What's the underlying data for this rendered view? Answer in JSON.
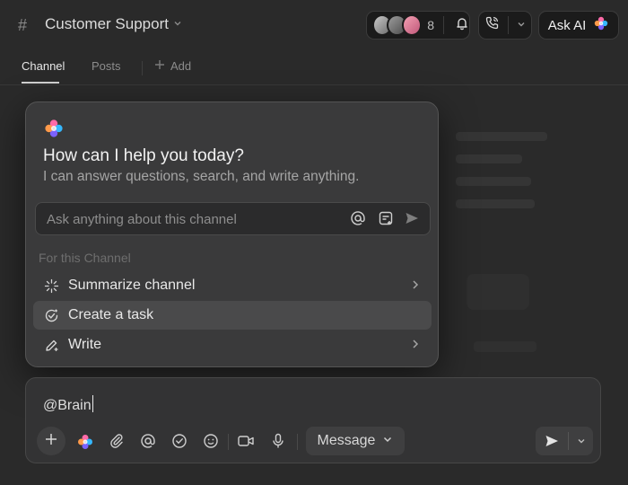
{
  "header": {
    "channel_title": "Customer Support",
    "member_count": "8",
    "ask_ai_label": "Ask AI"
  },
  "tabs": [
    {
      "label": "Channel",
      "active": true
    },
    {
      "label": "Posts",
      "active": false
    },
    {
      "label": "Add",
      "active": false
    }
  ],
  "assistant": {
    "heading": "How can I help you today?",
    "subheading": "I can answer questions, search, and write anything.",
    "input_placeholder": "Ask anything about this channel",
    "section_label": "For this Channel",
    "items": [
      {
        "label": "Summarize channel",
        "icon": "sparkle-icon",
        "has_submenu": true
      },
      {
        "label": "Create a task",
        "icon": "task-check-icon",
        "has_submenu": false
      },
      {
        "label": "Write",
        "icon": "pen-sparkle-icon",
        "has_submenu": true
      }
    ]
  },
  "composer": {
    "text": "@Brain",
    "message_type_label": "Message"
  },
  "colors": {
    "background": "#2a2a2a",
    "popup": "#3a3a3b",
    "highlight": "#4a4a4b",
    "brand_gradient": [
      "#ff6ba8",
      "#7b61ff",
      "#35b8ff"
    ]
  }
}
